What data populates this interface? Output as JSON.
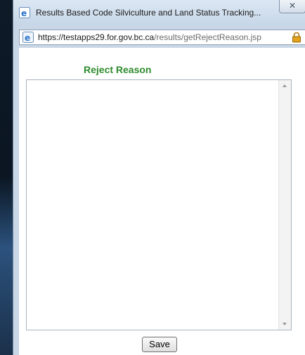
{
  "window": {
    "title": "Results Based Code Silviculture and Land Status Tracking...",
    "close_glyph": "✕",
    "title_icon": "ie-icon"
  },
  "address_bar": {
    "url_host": "https://testapps29.for.gov.bc.ca",
    "url_path": "/results/getRejectReason.jsp",
    "page_icon": "ie-page-icon",
    "secure_icon": "lock-icon"
  },
  "form": {
    "heading": "Reject Reason",
    "reason_value": "",
    "save_label": "Save"
  },
  "colors": {
    "heading": "#2e8b2e",
    "lock": "#e0a21a"
  }
}
